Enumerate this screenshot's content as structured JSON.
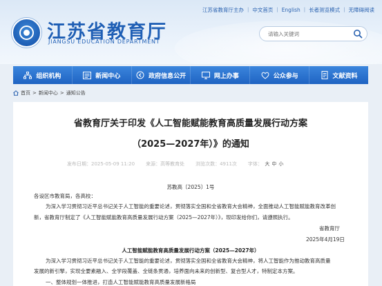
{
  "top_links": [
    "江苏省教育厅主办",
    "中文首页",
    "English",
    "长者测览模式",
    "无障碍阅读"
  ],
  "logo": {
    "cn": "江苏省教育厅",
    "en": "JIANGSU EDUCATION DEPARTMENT"
  },
  "search": {
    "placeholder": "请输入关键词"
  },
  "nav": [
    {
      "label": "组织机构",
      "icon": "org-chart-icon"
    },
    {
      "label": "新闻中心",
      "icon": "news-icon"
    },
    {
      "label": "政府信息公开",
      "icon": "info-disclosure-icon"
    },
    {
      "label": "网上办事",
      "icon": "online-service-icon"
    },
    {
      "label": "公众参与",
      "icon": "public-participation-icon"
    },
    {
      "label": "文献资料",
      "icon": "documents-icon"
    }
  ],
  "breadcrumb": [
    "首页",
    "新闻中心",
    "通知公告"
  ],
  "article": {
    "title_line1": "省教育厅关于印发《人工智能赋能教育高质量发展行动方案",
    "title_line2": "（2025—2027年）》的通知",
    "publish_time": "发布日期：2025-05-09 11:20",
    "source": "来源：高等教育处",
    "views": "浏览次数：4911次",
    "font_label": "字体：",
    "font_sizes": [
      "大",
      "中",
      "小"
    ],
    "doc_number": "苏教高〔2025〕1号",
    "salutation": "各设区市教育局，各高校：",
    "para1_line1": "为深入学习贯彻习近平总书记关于人工智能的重要论述，贯彻落实全国和全省教育大会精神，全面推动人工智能赋能教育改革创",
    "para1_line2": "新，省教育厅制定了《人工智能赋能教育高质量发展行动方案（2025—2027年）》，现印发给你们，请遵照执行。",
    "signature": "省教育厅",
    "date": "2025年4月19日",
    "plan_title": "人工智能赋能教育高质量发展行动方案（2025—2027年）",
    "para2_line1": "为深入学习贯彻习近平总书记关于人工智能的重要论述，贯彻落实全国和全省教育大会精神，将人工智能作为推动教育高质量",
    "para2_line2": "发展的新引擎，实现全要素融入、全学段覆盖、全链条贯通，培养面向未来的创新型、复合型人才，特制定本方案。",
    "section1": "一、整体规划一体推进，打造人工智能赋能教育高质量发展新格局"
  },
  "colors": {
    "nav_top": "#3b86dd",
    "nav_bottom": "#1f63c2",
    "brand_blue": "#1f5fb5",
    "background": "#e9eff6"
  }
}
